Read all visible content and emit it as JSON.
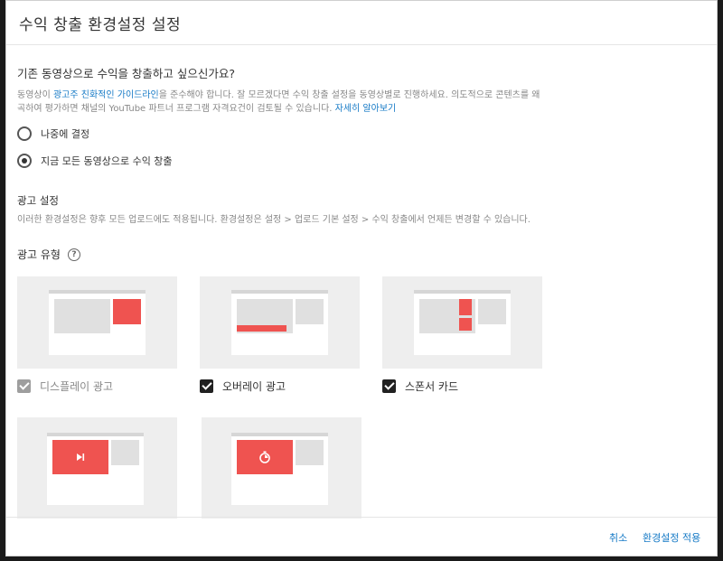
{
  "header": {
    "title": "수익 창출 환경설정 설정"
  },
  "monetize": {
    "question": "기존 동영상으로 수익을 창출하고 싶으신가요?",
    "desc_prefix": "동영상이 ",
    "desc_link": "광고주 친화적인 가이드라인",
    "desc_middle": "을 준수해야 합니다. 잘 모르겠다면 수익 창출 설정을 동영상별로 진행하세요. 의도적으로 콘텐츠를 왜곡하여 평가하면 채널의 YouTube 파트너 프로그램 자격요건이 검토될 수 있습니다. ",
    "learn_more": "자세히 알아보기",
    "options": [
      {
        "label": "나중에 결정",
        "selected": false
      },
      {
        "label": "지금 모든 동영상으로 수익 창출",
        "selected": true
      }
    ]
  },
  "ad_settings": {
    "title": "광고 설정",
    "desc": "이러한 환경설정은 향후 모든 업로드에도 적용됩니다. 환경설정은 설정 > 업로드 기본 설정 > 수익 창출에서 언제든 변경할 수 있습니다."
  },
  "ad_types": {
    "label": "광고 유형",
    "help_icon": "?",
    "items": [
      {
        "label": "디스플레이 광고",
        "checked": true,
        "disabled": true
      },
      {
        "label": "오버레이 광고",
        "checked": true,
        "disabled": false
      },
      {
        "label": "스폰서 카드",
        "checked": true,
        "disabled": false
      }
    ]
  },
  "footer": {
    "cancel": "취소",
    "apply": "환경설정 적용"
  },
  "colors": {
    "accent": "#167ac6",
    "ad_red": "#ef5350"
  }
}
